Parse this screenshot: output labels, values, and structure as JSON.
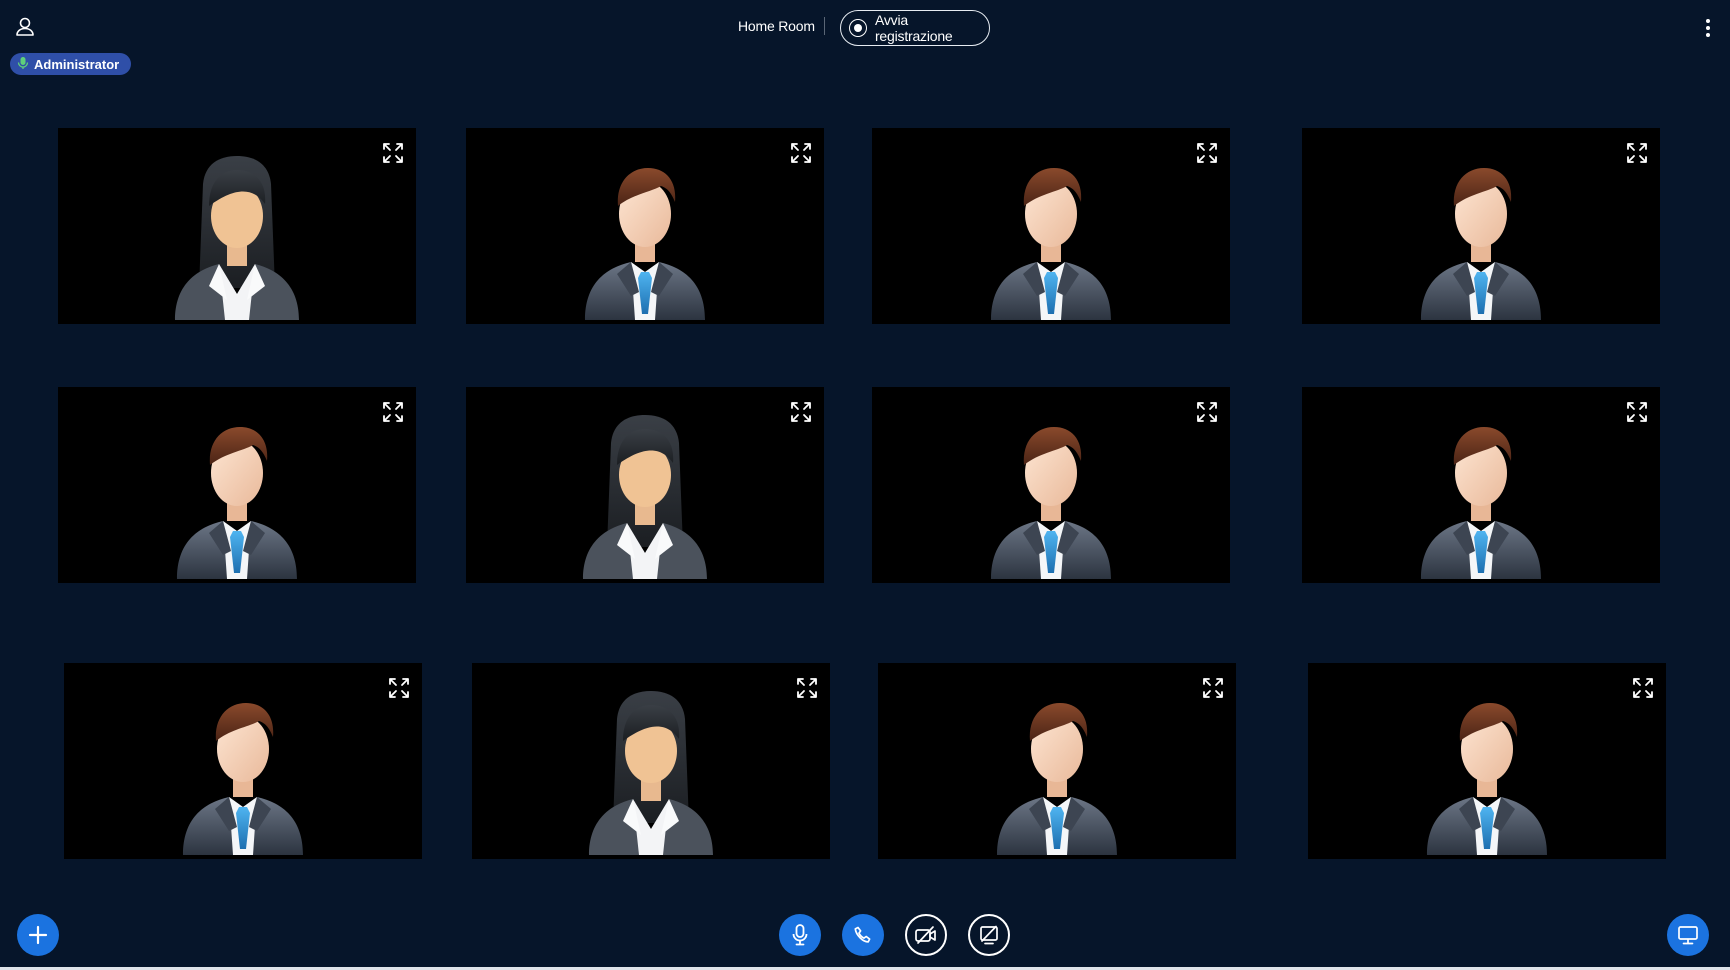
{
  "header": {
    "room_title": "Home Room",
    "record_label": "Avvia registrazione",
    "user_icon": "user-icon",
    "menu_icon": "more-vertical-icon"
  },
  "badge": {
    "label": "Administrator",
    "icon": "microphone-icon",
    "color": "#2f4fa8"
  },
  "participants": [
    {
      "avatar": "female"
    },
    {
      "avatar": "male"
    },
    {
      "avatar": "male"
    },
    {
      "avatar": "male"
    },
    {
      "avatar": "male"
    },
    {
      "avatar": "female"
    },
    {
      "avatar": "male"
    },
    {
      "avatar": "male"
    },
    {
      "avatar": "male"
    },
    {
      "avatar": "female"
    },
    {
      "avatar": "male"
    },
    {
      "avatar": "male"
    }
  ],
  "controls": {
    "add": "plus-icon",
    "mic": "microphone-icon",
    "call": "phone-icon",
    "camera": "camera-off-icon",
    "share": "screen-share-off-icon",
    "present": "monitor-icon"
  },
  "colors": {
    "background": "#06152a",
    "accent": "#1b73e0",
    "tile": "#000000"
  }
}
